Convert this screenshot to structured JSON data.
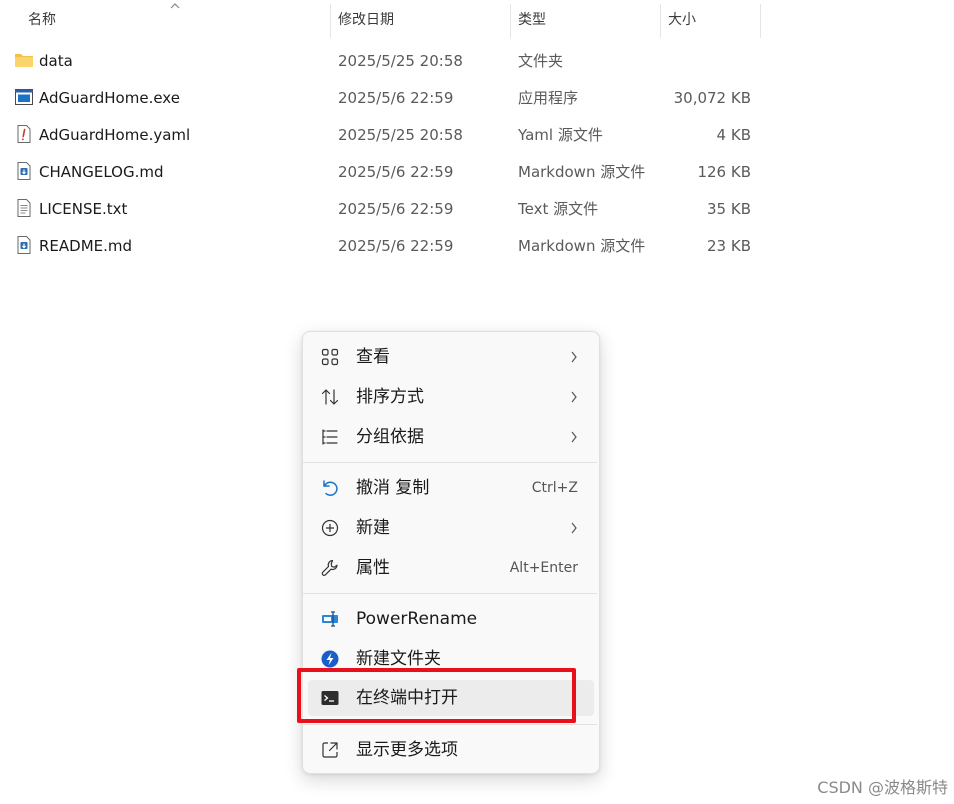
{
  "columns": {
    "name": "名称",
    "modified": "修改日期",
    "type": "类型",
    "size": "大小"
  },
  "files": [
    {
      "icon": "folder-icon",
      "name": "data",
      "date": "2025/5/25 20:58",
      "type": "文件夹",
      "size": ""
    },
    {
      "icon": "exe-icon",
      "name": "AdGuardHome.exe",
      "date": "2025/5/6 22:59",
      "type": "应用程序",
      "size": "30,072 KB"
    },
    {
      "icon": "yaml-file-icon",
      "name": "AdGuardHome.yaml",
      "date": "2025/5/25 20:58",
      "type": "Yaml 源文件",
      "size": "4 KB"
    },
    {
      "icon": "markdown-file-icon",
      "name": "CHANGELOG.md",
      "date": "2025/5/6 22:59",
      "type": "Markdown 源文件",
      "size": "126 KB"
    },
    {
      "icon": "text-file-icon",
      "name": "LICENSE.txt",
      "date": "2025/5/6 22:59",
      "type": "Text 源文件",
      "size": "35 KB"
    },
    {
      "icon": "markdown-file-icon",
      "name": "README.md",
      "date": "2025/5/6 22:59",
      "type": "Markdown 源文件",
      "size": "23 KB"
    }
  ],
  "menu": {
    "items": [
      {
        "icon": "grid-view-icon",
        "label": "查看",
        "shortcut": "",
        "submenu": true
      },
      {
        "icon": "sort-arrows-icon",
        "label": "排序方式",
        "shortcut": "",
        "submenu": true
      },
      {
        "icon": "group-list-icon",
        "label": "分组依据",
        "shortcut": "",
        "submenu": true
      },
      {
        "icon": "undo-icon",
        "label": "撤消 复制",
        "shortcut": "Ctrl+Z",
        "submenu": false
      },
      {
        "icon": "plus-circle-icon",
        "label": "新建",
        "shortcut": "",
        "submenu": true
      },
      {
        "icon": "wrench-icon",
        "label": "属性",
        "shortcut": "Alt+Enter",
        "submenu": false
      },
      {
        "icon": "powerrename-icon",
        "label": "PowerRename",
        "shortcut": "",
        "submenu": false
      },
      {
        "icon": "new-folder-bolt-icon",
        "label": "新建文件夹",
        "shortcut": "",
        "submenu": false
      },
      {
        "icon": "terminal-icon",
        "label": "在终端中打开",
        "shortcut": "",
        "submenu": false
      },
      {
        "icon": "external-open-icon",
        "label": "显示更多选项",
        "shortcut": "",
        "submenu": false
      }
    ]
  },
  "watermark": "CSDN @波格斯特",
  "colors": {
    "highlight_box": "#e8101a",
    "accent_blue": "#1a73c8",
    "folder_yellow": "#f4c04a"
  }
}
